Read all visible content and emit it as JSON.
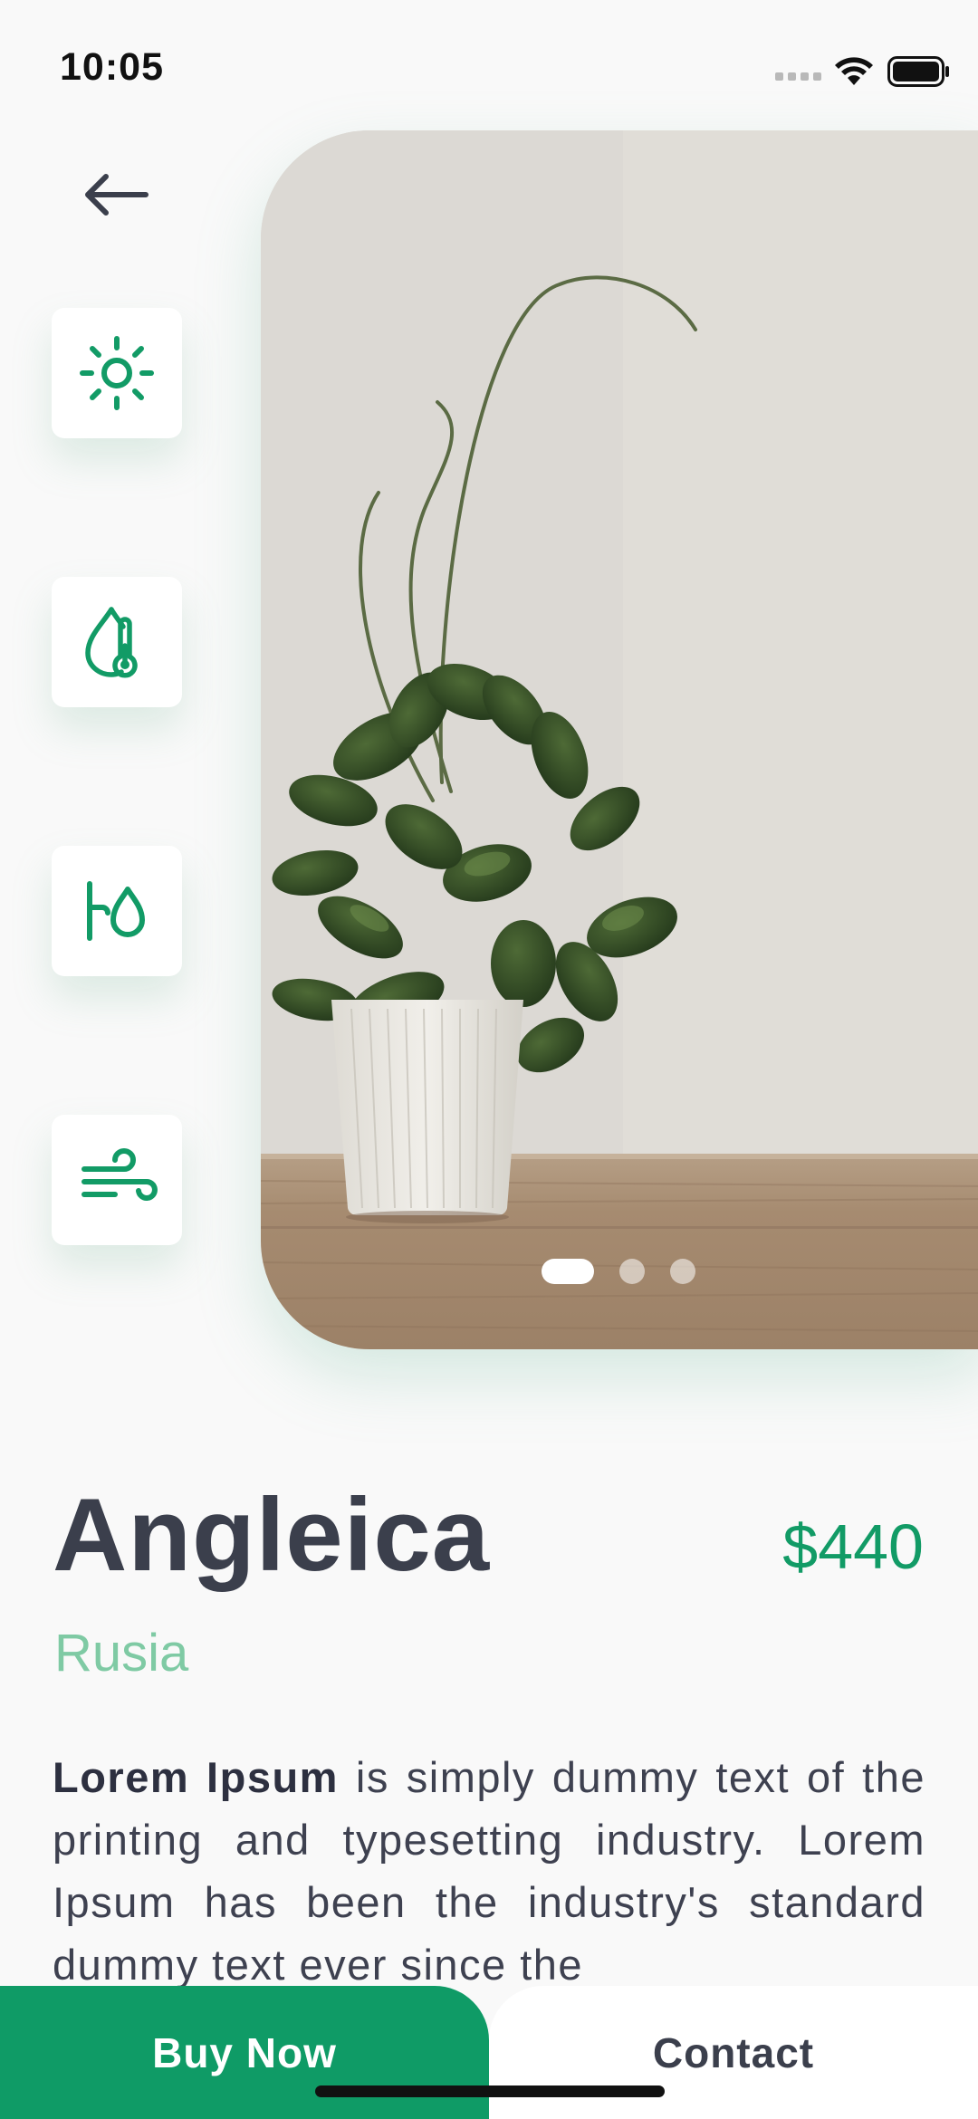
{
  "status_bar": {
    "time": "10:05"
  },
  "features": [
    {
      "icon": "sun-icon"
    },
    {
      "icon": "humidity-thermometer-icon"
    },
    {
      "icon": "watering-icon"
    },
    {
      "icon": "wind-icon"
    }
  ],
  "carousel": {
    "slides": 3,
    "active_index": 0
  },
  "plant": {
    "name": "Angleica",
    "price": "$440",
    "origin": "Rusia",
    "description_bold": "Lorem Ipsum",
    "description_rest": " is simply dummy text of the printing and typesetting industry. Lorem Ipsum has been the industry's standard dummy text ever since the"
  },
  "actions": {
    "buy_label": "Buy Now",
    "contact_label": "Contact"
  },
  "colors": {
    "accent": "#0f9b66",
    "accent_light": "#7fcaa4",
    "text_dark": "#3b3f4c"
  }
}
